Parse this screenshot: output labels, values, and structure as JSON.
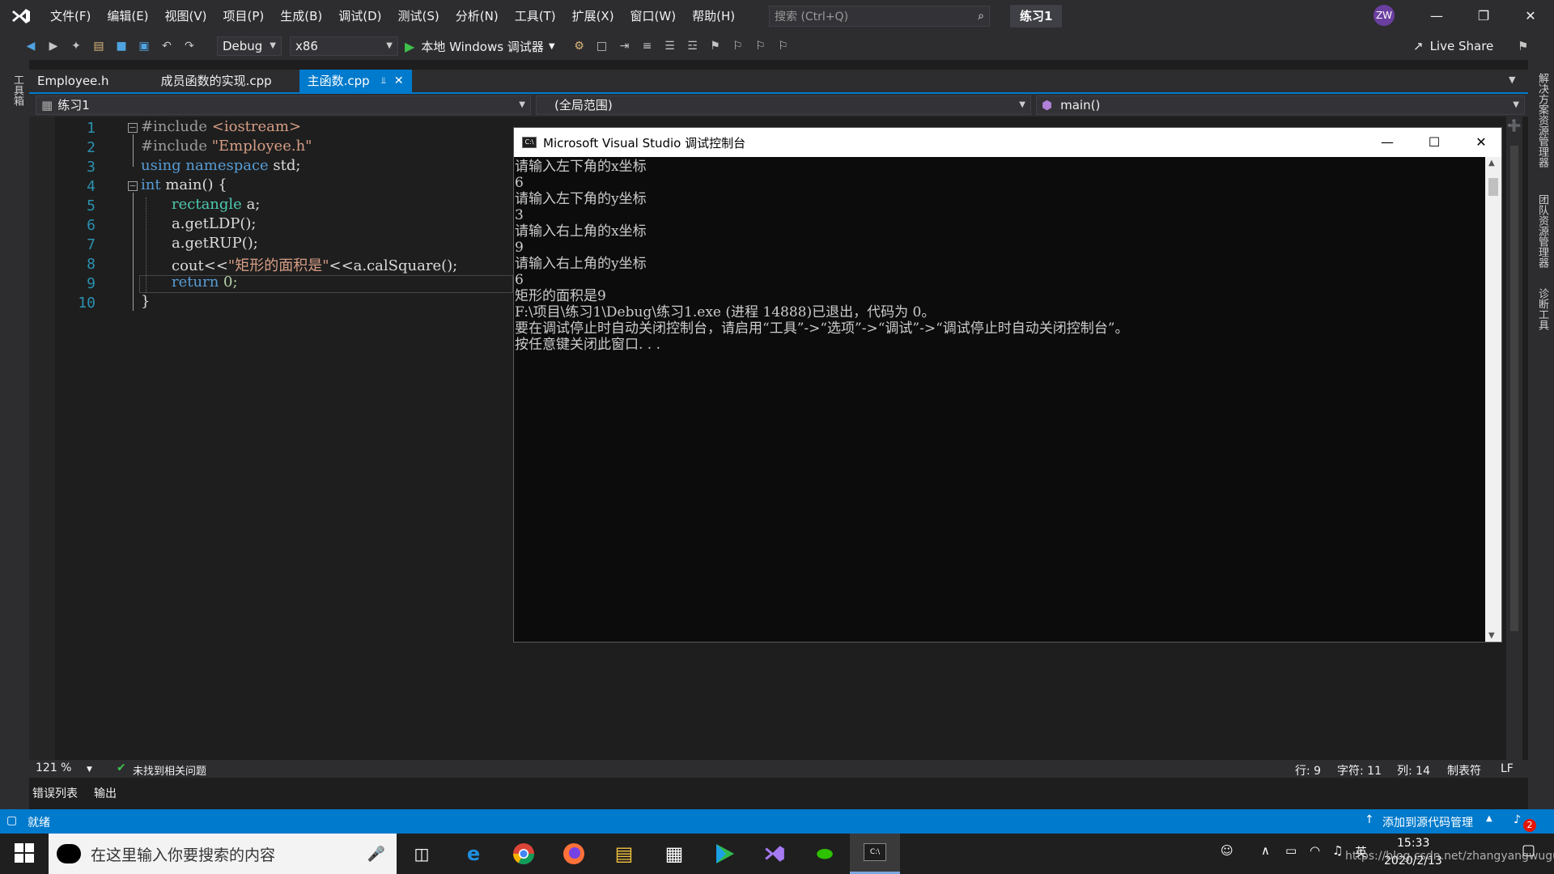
{
  "menubar": {
    "items": [
      "文件(F)",
      "编辑(E)",
      "视图(V)",
      "项目(P)",
      "生成(B)",
      "调试(D)",
      "测试(S)",
      "分析(N)",
      "工具(T)",
      "扩展(X)",
      "窗口(W)",
      "帮助(H)"
    ],
    "search_placeholder": "搜索 (Ctrl+Q)",
    "solution_title": "练习1",
    "avatar": "ZW"
  },
  "toolbar": {
    "config": "Debug",
    "platform": "x86",
    "run_label": "本地 Windows 调试器",
    "live_share": "Live Share"
  },
  "side": {
    "left_label": "工具箱",
    "right_labels": [
      "解决方案资源管理器",
      "团队资源管理器",
      "诊断工具"
    ]
  },
  "tabs": [
    {
      "label": "Employee.h"
    },
    {
      "label": "成员函数的实现.cpp"
    },
    {
      "label": "主函数.cpp"
    }
  ],
  "navbar": {
    "project": "练习1",
    "scope": "(全局范围)",
    "member": "main()"
  },
  "code": {
    "line_numbers": [
      "1",
      "2",
      "3",
      "4",
      "5",
      "6",
      "7",
      "8",
      "9",
      "10"
    ],
    "l1a": "#include ",
    "l1b": "<iostream>",
    "l2a": "#include ",
    "l2b": "\"Employee.h\"",
    "l3a": "using namespace ",
    "l3b": "std;",
    "l4a": "int ",
    "l4b": "main() {",
    "l5a": "rectangle ",
    "l5b": "a;",
    "l6": "a.getLDP();",
    "l7": "a.getRUP();",
    "l8a": "cout<<",
    "l8b": "\"矩形的面积是\"",
    "l8c": "<<a.calSquare();",
    "l9a": "return ",
    "l9b": "0;",
    "l10": "}"
  },
  "console": {
    "title": "Microsoft Visual Studio 调试控制台",
    "lines": [
      "请输入左下角的x坐标",
      "6",
      "请输入左下角的y坐标",
      "3",
      "请输入右上角的x坐标",
      "9",
      "请输入右上角的y坐标",
      "6",
      "矩形的面积是9",
      "F:\\项目\\练习1\\Debug\\练习1.exe (进程 14888)已退出，代码为 0。",
      "要在调试停止时自动关闭控制台，请启用“工具”->“选项”->“调试”->“调试停止时自动关闭控制台”。",
      "按任意键关闭此窗口. . ."
    ]
  },
  "status_row": {
    "zoom": "121 %",
    "issues": "未找到相关问题",
    "row": "行: 9",
    "char": "字符: 11",
    "col": "列: 14",
    "tab": "制表符",
    "eol": "LF"
  },
  "output_tabs": [
    "错误列表",
    "输出"
  ],
  "statusbar": {
    "ready": "就绪",
    "source_control": "添加到源代码管理",
    "notifications": "2"
  },
  "taskbar": {
    "search_placeholder": "在这里输入你要搜索的内容",
    "time": "15:33",
    "date": "2020/2/13",
    "ime": "英",
    "watermark": "https://blog.csdn.net/zhangyangwugui"
  },
  "colors": {
    "accent": "#007acc",
    "keyword": "#569cd6",
    "string": "#d69d85",
    "type": "#4ec9b0",
    "line_number": "#2b91af"
  }
}
